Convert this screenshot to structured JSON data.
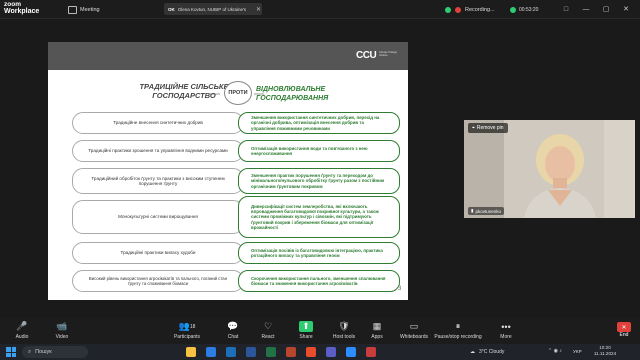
{
  "app": {
    "logo_line1": "zoom",
    "logo_line2": "Workplace"
  },
  "topbar": {
    "meeting_label": "Meeting",
    "share_chip": {
      "prefix": "OK",
      "text": "Olena Kovtun, NUBIP of Ukraine's",
      "close": "✕"
    },
    "recording_label": "Recording...",
    "timer": "00:53:20",
    "window_controls": [
      "□",
      "—",
      "▢",
      "✕"
    ]
  },
  "slide": {
    "logo": "CCU",
    "logo_sub": "Climate Change Ukraine",
    "left_title": "ТРАДИЦІЙНЕ СІЛЬСЬКЕ ГОСПОДАРСТВО",
    "vs_label": "ПРОТИ",
    "right_title": "ВІДНОВЛЮВАЛЬНЕ ГОСПОДАРЮВАННЯ",
    "rows": [
      {
        "left": "Традиційне внесення синтетичних добрив",
        "right": "Зменшення використання синтетичних добрив, перехід на органічні добрива, оптимізація внесення добрив та управління поживними речовинами"
      },
      {
        "left": "Традиційні практики зрошення та управління водними ресурсами",
        "right": "Оптимізація використання води та пов'язаного з нею енергоспоживання"
      },
      {
        "left": "Традиційний обробіток ґрунту та практики з високим ступенем порушення ґрунту",
        "right": "Зменшення практик порушення ґрунту та переходом до мінімального/нульового обробітку ґрунту разом з постійним органічним ґрунтовим покривом"
      },
      {
        "left": "Монокультурні системи вирощування",
        "right": "Диверсифікації систем землеробства, які включають впровадження багатовидової покривної культури, а також системи проміжних культур і сівозмін, які підтримують ґрунтовий покрив і збереження біомаси для оптимізації врожайності"
      },
      {
        "left": "Традиційні практики випасу худоби",
        "right": "Оптимізація посівів із багатовидовою інтеграцією, практика ротаційного випасу та управління гноєм"
      },
      {
        "left": "Високий рівень використання агрохімікатів та пального, поганий стан ґрунту та споживання біомаси",
        "right": "Скорочення використання пального, зменшення спалювання біомаси та зниження використання агрохімікатів"
      }
    ],
    "page_number": "3"
  },
  "video": {
    "remove_pin": "Remove pin",
    "name": "pkovtunenko"
  },
  "toolbar": {
    "items": [
      {
        "label": "Audio",
        "icon": "🎤"
      },
      {
        "label": "Video",
        "icon": "📹"
      },
      {
        "label": "Participants",
        "icon": "👥",
        "count": "18"
      },
      {
        "label": "Chat",
        "icon": "💬"
      },
      {
        "label": "React",
        "icon": "♡"
      },
      {
        "label": "Share",
        "icon": "⬆"
      },
      {
        "label": "Host tools",
        "icon": "🛡"
      },
      {
        "label": "Apps",
        "icon": "▦"
      },
      {
        "label": "Whiteboards",
        "icon": "▭"
      },
      {
        "label": "Pause/stop recording",
        "icon": "⏸"
      },
      {
        "label": "More",
        "icon": "•••"
      }
    ],
    "end_label": "End"
  },
  "taskbar": {
    "search_placeholder": "Пошук",
    "weather": "3°C Cloudy",
    "lang": "УКР",
    "time": "10:20",
    "date": "11.11.2024"
  },
  "colors": {
    "green": "#2e7d32",
    "record_red": "#e0413a"
  }
}
